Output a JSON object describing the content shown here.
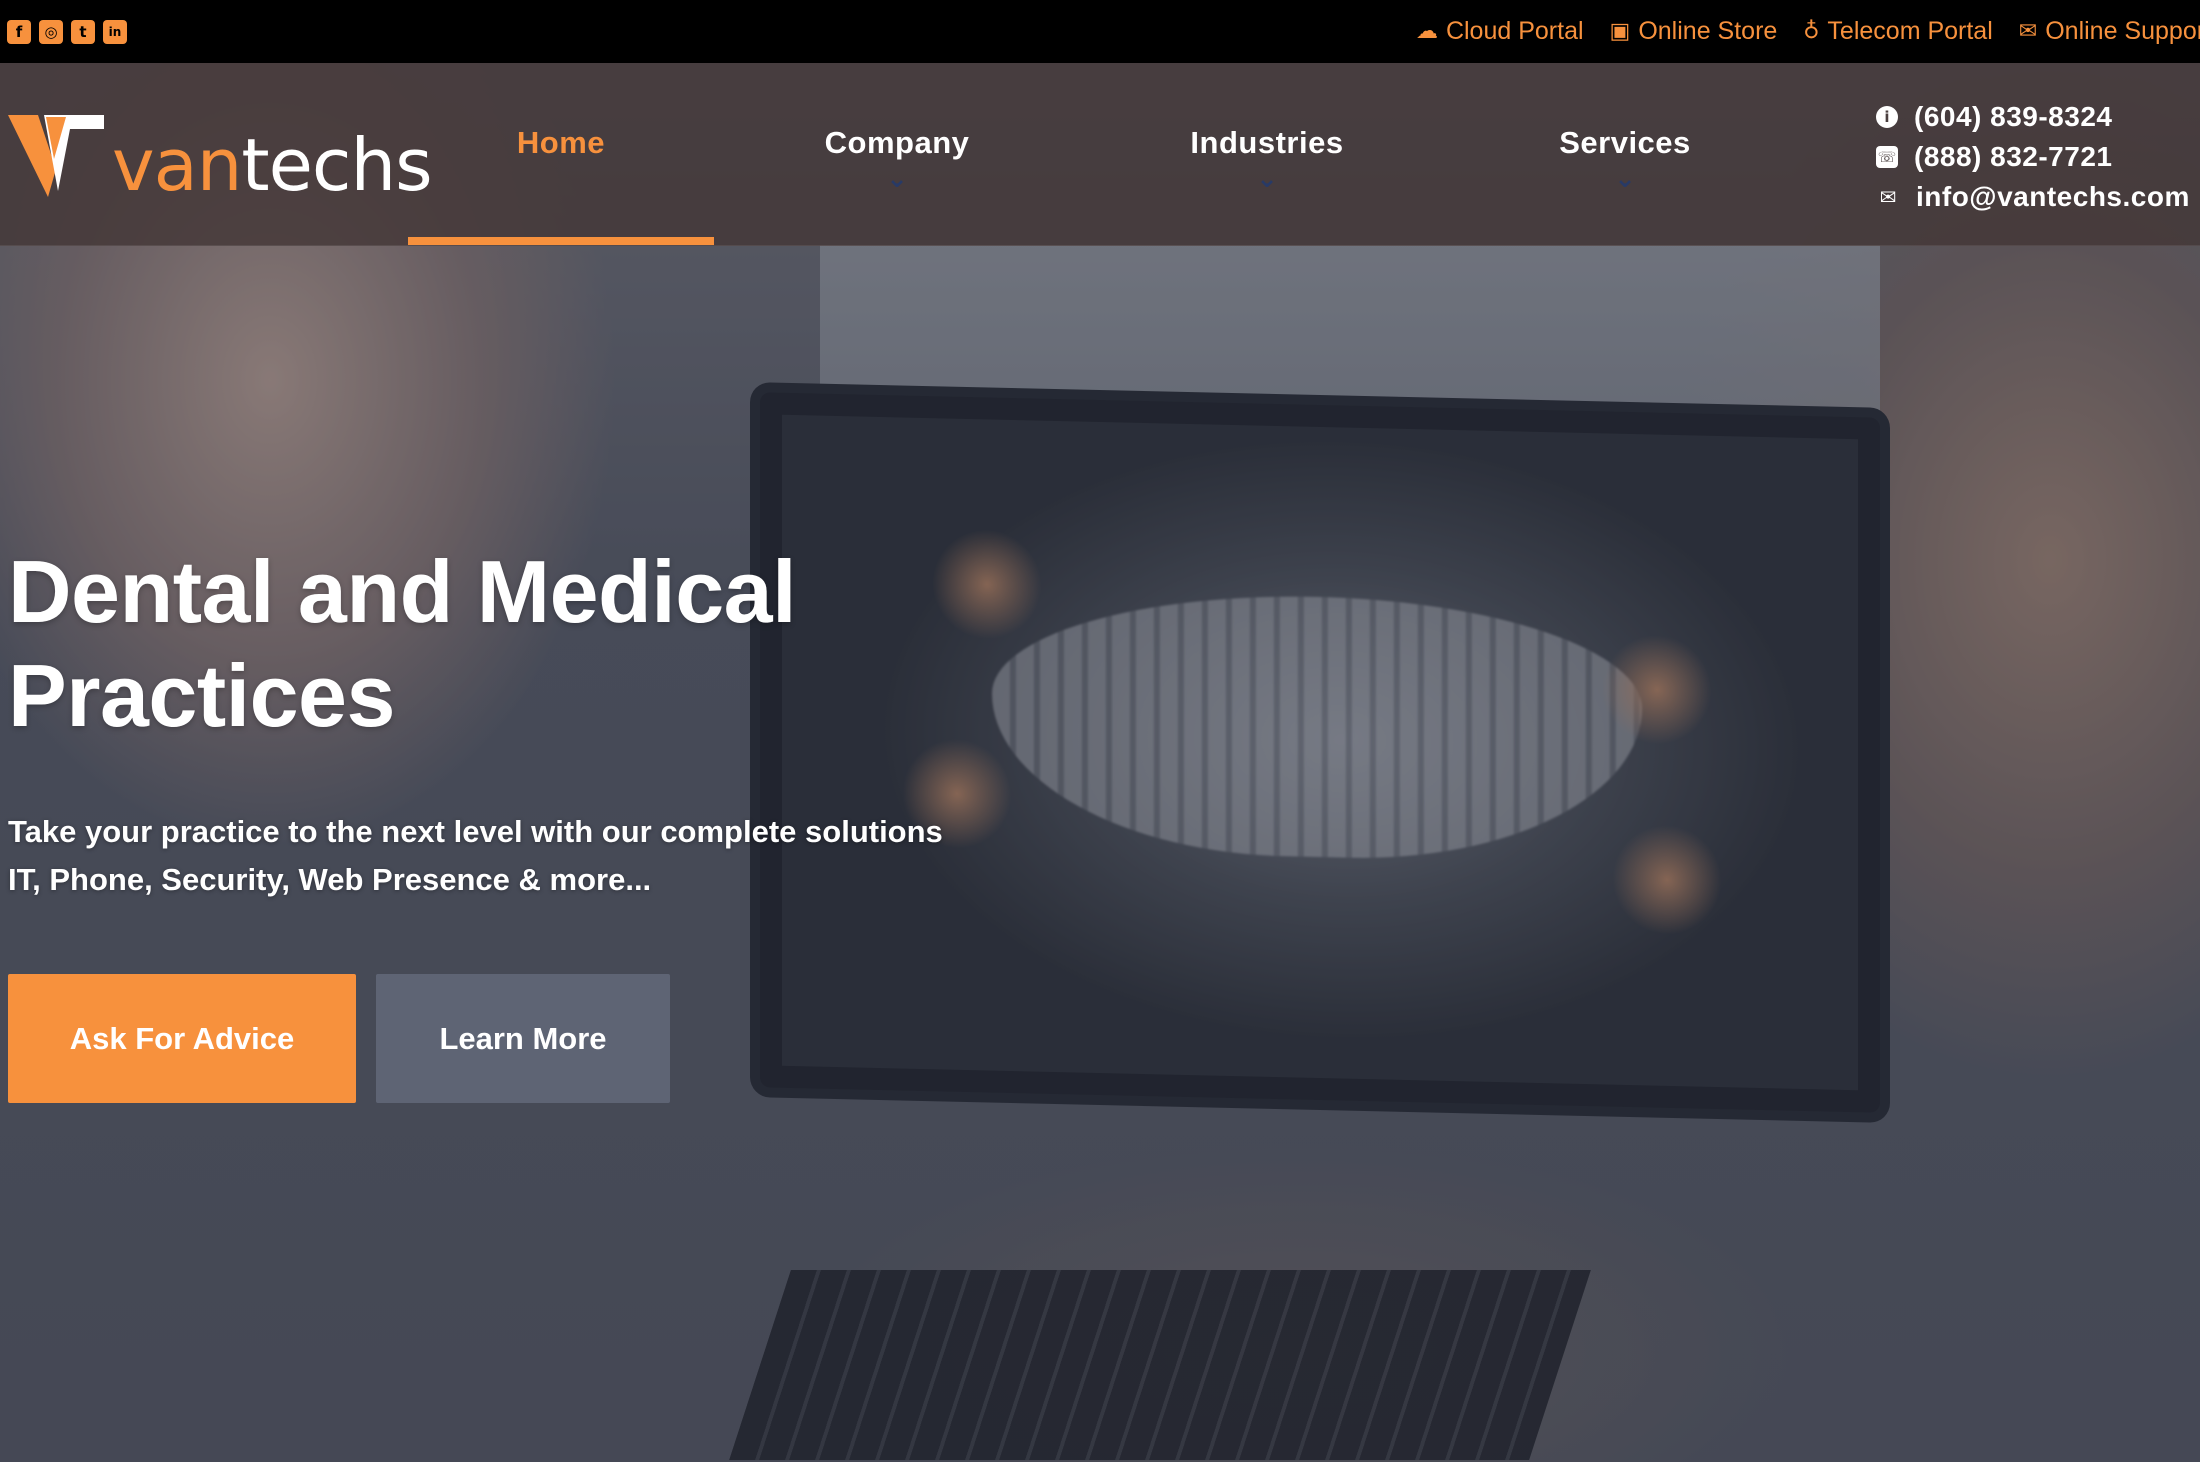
{
  "colors": {
    "accent": "#f7913d",
    "topbar": "#000000",
    "nav_chevron": "#283a66",
    "secondary_button": "#5e6474"
  },
  "social": [
    {
      "name": "facebook-icon",
      "glyph": "f"
    },
    {
      "name": "instagram-icon",
      "glyph": "◎"
    },
    {
      "name": "twitter-icon",
      "glyph": "t"
    },
    {
      "name": "linkedin-icon",
      "glyph": "in"
    }
  ],
  "portals": [
    {
      "icon": "cloud-icon",
      "glyph": "☁",
      "label": "Cloud Portal"
    },
    {
      "icon": "store-icon",
      "glyph": "▣",
      "label": "Online Store"
    },
    {
      "icon": "telecom-icon",
      "glyph": "♁",
      "label": "Telecom Portal"
    },
    {
      "icon": "support-chat-icon",
      "glyph": "✉",
      "label": "Online Support"
    }
  ],
  "logo": {
    "part1": "van",
    "part2": "techs"
  },
  "nav": {
    "home": "Home",
    "company": "Company",
    "industries": "Industries",
    "services": "Services",
    "active": "Home"
  },
  "contact": {
    "phone1": "(604) 839-8324",
    "phone2": "(888) 832-7721",
    "email": "info@vantechs.com"
  },
  "hero": {
    "title_line1": "Dental and Medical",
    "title_line2": "Practices",
    "sub_line1": "Take your practice to the next level with our complete solutions",
    "sub_line2": "IT, Phone, Security, Web Presence & more...",
    "primary_button": "Ask For Advice",
    "secondary_button": "Learn More"
  }
}
